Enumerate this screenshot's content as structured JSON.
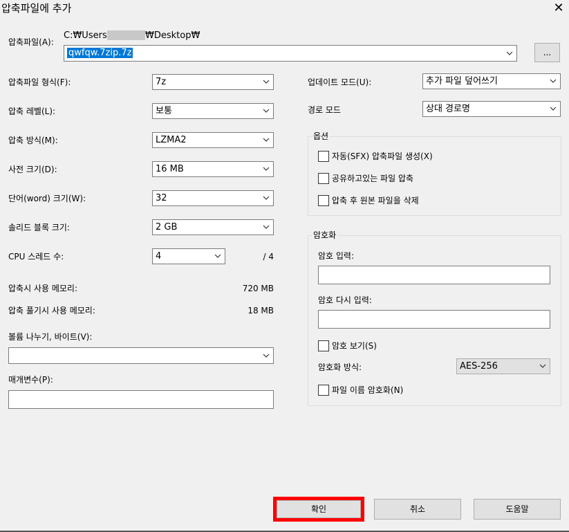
{
  "window": {
    "title": "압축파일에 추가",
    "close_glyph": "✕"
  },
  "archive": {
    "label": "압축파일(A):",
    "path_prefix": "C:₩Users",
    "path_suffix": "₩Desktop₩",
    "filename": "qwfqw.7zip.7z",
    "browse_label": "..."
  },
  "left": {
    "format": {
      "label": "압축파일 형식(F):",
      "value": "7z"
    },
    "level": {
      "label": "압축 레벨(L):",
      "value": "보통"
    },
    "method": {
      "label": "압축 방식(M):",
      "value": "LZMA2"
    },
    "dict": {
      "label": "사전 크기(D):",
      "value": "16 MB"
    },
    "word": {
      "label": "단어(word) 크기(W):",
      "value": "32"
    },
    "solid": {
      "label": "솔리드 블록 크기:",
      "value": "2 GB"
    },
    "cpu": {
      "label": "CPU 스레드 수:",
      "value": "4",
      "max": "/ 4"
    },
    "mem_compress": {
      "label": "압축시 사용 메모리:",
      "value": "720 MB"
    },
    "mem_decompress": {
      "label": "압축 풀기시 사용 메모리:",
      "value": "18 MB"
    },
    "volume": {
      "label": "볼륨 나누기, 바이트(V):",
      "value": ""
    },
    "params": {
      "label": "매개변수(P):",
      "value": ""
    }
  },
  "right": {
    "update_mode": {
      "label": "업데이트 모드(U):",
      "value": "추가 파일 덮어쓰기"
    },
    "path_mode": {
      "label": "경로 모드",
      "value": "상대 경로명"
    },
    "options": {
      "title": "옵션",
      "sfx": "자동(SFX) 압축파일 생성(X)",
      "shared": "공유하고있는 파일 압축",
      "delete": "압축 후 원본 파일을 삭제"
    },
    "encryption": {
      "title": "암호화",
      "password_label": "암호 입력:",
      "repeat_label": "암호 다시 입력:",
      "show_label": "암호 보기(S)",
      "method_label": "암호화 방식:",
      "method_value": "AES-256",
      "names_label": "파일 이름 암호화(N)"
    }
  },
  "buttons": {
    "ok": "확인",
    "cancel": "취소",
    "help": "도움말"
  },
  "colors": {
    "highlight": "#ff0000",
    "selection": "#0078d7"
  }
}
